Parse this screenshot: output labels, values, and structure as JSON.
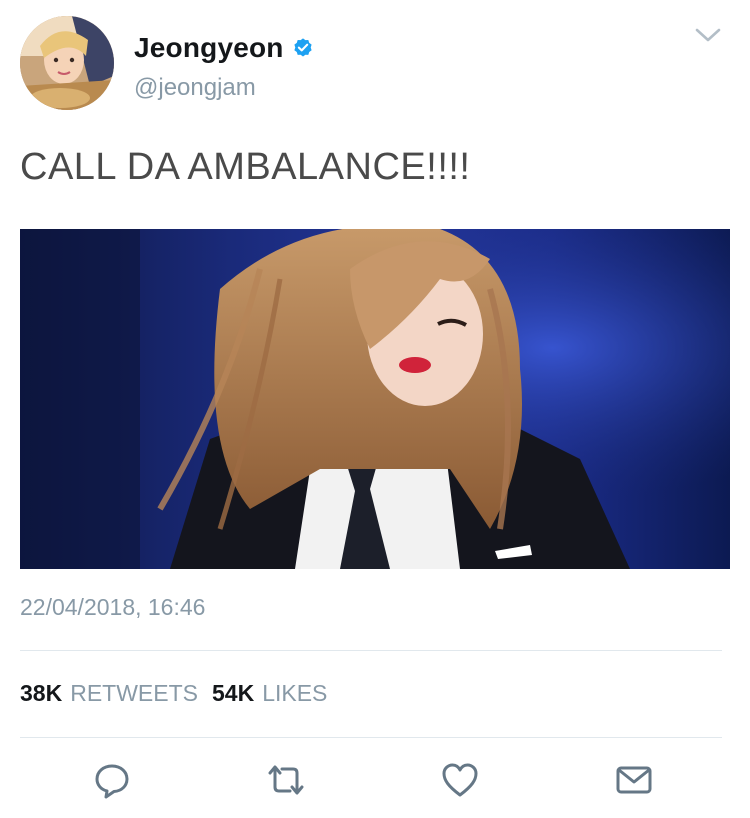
{
  "author": {
    "display_name": "Jeongyeon",
    "handle": "@jeongjam",
    "verified": true
  },
  "tweet": {
    "text": "CALL DA AMBALANCE!!!!",
    "timestamp": "22/04/2018, 16:46"
  },
  "stats": {
    "retweets_count": "38K",
    "retweets_label": "RETWEETS",
    "likes_count": "54K",
    "likes_label": "LIKES"
  },
  "icons": {
    "menu": "chevron-down-icon",
    "verified": "verified-badge-icon",
    "reply": "reply-icon",
    "retweet": "retweet-icon",
    "like": "heart-icon",
    "share": "envelope-icon"
  },
  "colors": {
    "accent": "#1da1f2",
    "muted": "#8899a6",
    "text": "#14171a",
    "body_text": "#4a4a4a",
    "icon": "#657786"
  }
}
